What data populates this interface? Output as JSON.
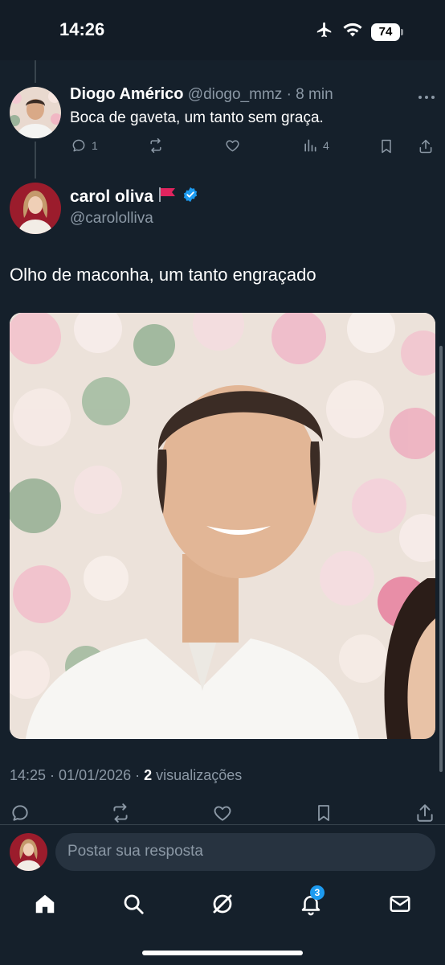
{
  "status_bar": {
    "time": "14:26",
    "battery": "74"
  },
  "parent_tweet": {
    "author_name": "Diogo Américo",
    "handle": "@diogo_mmz",
    "separator": "·",
    "age": "8 min",
    "text": "Boca de gaveta, um tanto sem graça.",
    "reply_count": "1",
    "view_count": "4"
  },
  "main_tweet": {
    "author_name": "carol oliva",
    "handle": "@carololliva",
    "text": "Olho de maconha, um tanto engraçado",
    "time": "14:25",
    "date": "01/01/2026",
    "views_count": "2",
    "views_label": "visualizações"
  },
  "reply": {
    "placeholder": "Postar sua resposta"
  },
  "tab_bar": {
    "notifications_badge": "3"
  },
  "colors": {
    "background": "#15202b",
    "accent": "#1d9bf0",
    "muted": "#8b98a5",
    "flag": "#e0245e"
  }
}
